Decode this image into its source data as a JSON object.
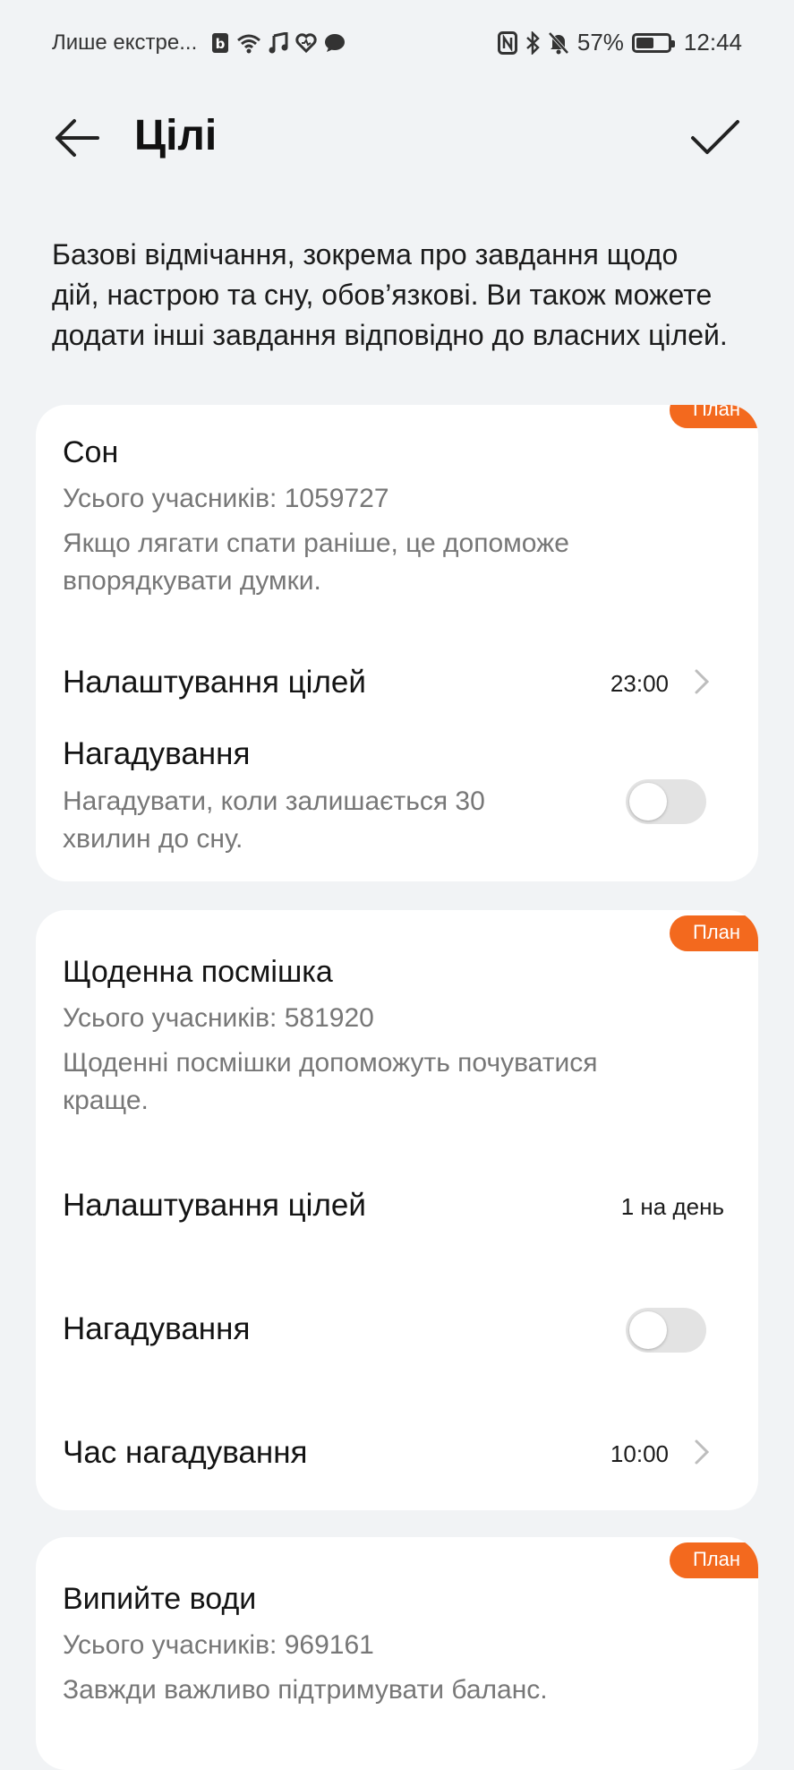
{
  "status_bar": {
    "carrier_text": "Лише екстре...",
    "battery_percent": "57%",
    "battery_level": 0.57,
    "time": "12:44",
    "left_icons": [
      "b-app-icon",
      "wifi-icon",
      "music-note-icon",
      "heart-icon",
      "chat-bubble-icon"
    ],
    "right_icons": [
      "nfc-icon",
      "bluetooth-icon",
      "mute-bell-icon",
      "battery-icon"
    ]
  },
  "app_bar": {
    "title": "Цілі",
    "back_icon": "arrow-left-icon",
    "confirm_icon": "checkmark-icon"
  },
  "description": "Базові відмічання, зокрема про завдання щодо дій, настрою та сну, обов’язкові. Ви також можете додати інші завдання відповідно до власних цілей.",
  "accent_color": "#f3691e",
  "goals": [
    {
      "badge": "План",
      "title": "Сон",
      "participants": "Усього учасників: 1059727",
      "description": "Якщо лягати спати раніше, це допоможе впорядкувати думки.",
      "settings_label": "Налаштування цілей",
      "settings_value": "23:00",
      "reminder_label": "Нагадування",
      "reminder_sub": "Нагадувати, коли залишається 30 хвилин до сну.",
      "reminder_on": false
    },
    {
      "badge": "План",
      "title": "Щоденна посмішка",
      "participants": "Усього учасників: 581920",
      "description": "Щоденні посмішки допоможуть почуватися краще.",
      "settings_label": "Налаштування цілей",
      "settings_value": "1 на день",
      "reminder_label": "Нагадування",
      "reminder_on": false,
      "reminder_time_label": "Час нагадування",
      "reminder_time_value": "10:00"
    },
    {
      "badge": "План",
      "title": "Випийте води",
      "participants": "Усього учасників: 969161",
      "description": "Завжди важливо підтримувати баланс."
    }
  ]
}
